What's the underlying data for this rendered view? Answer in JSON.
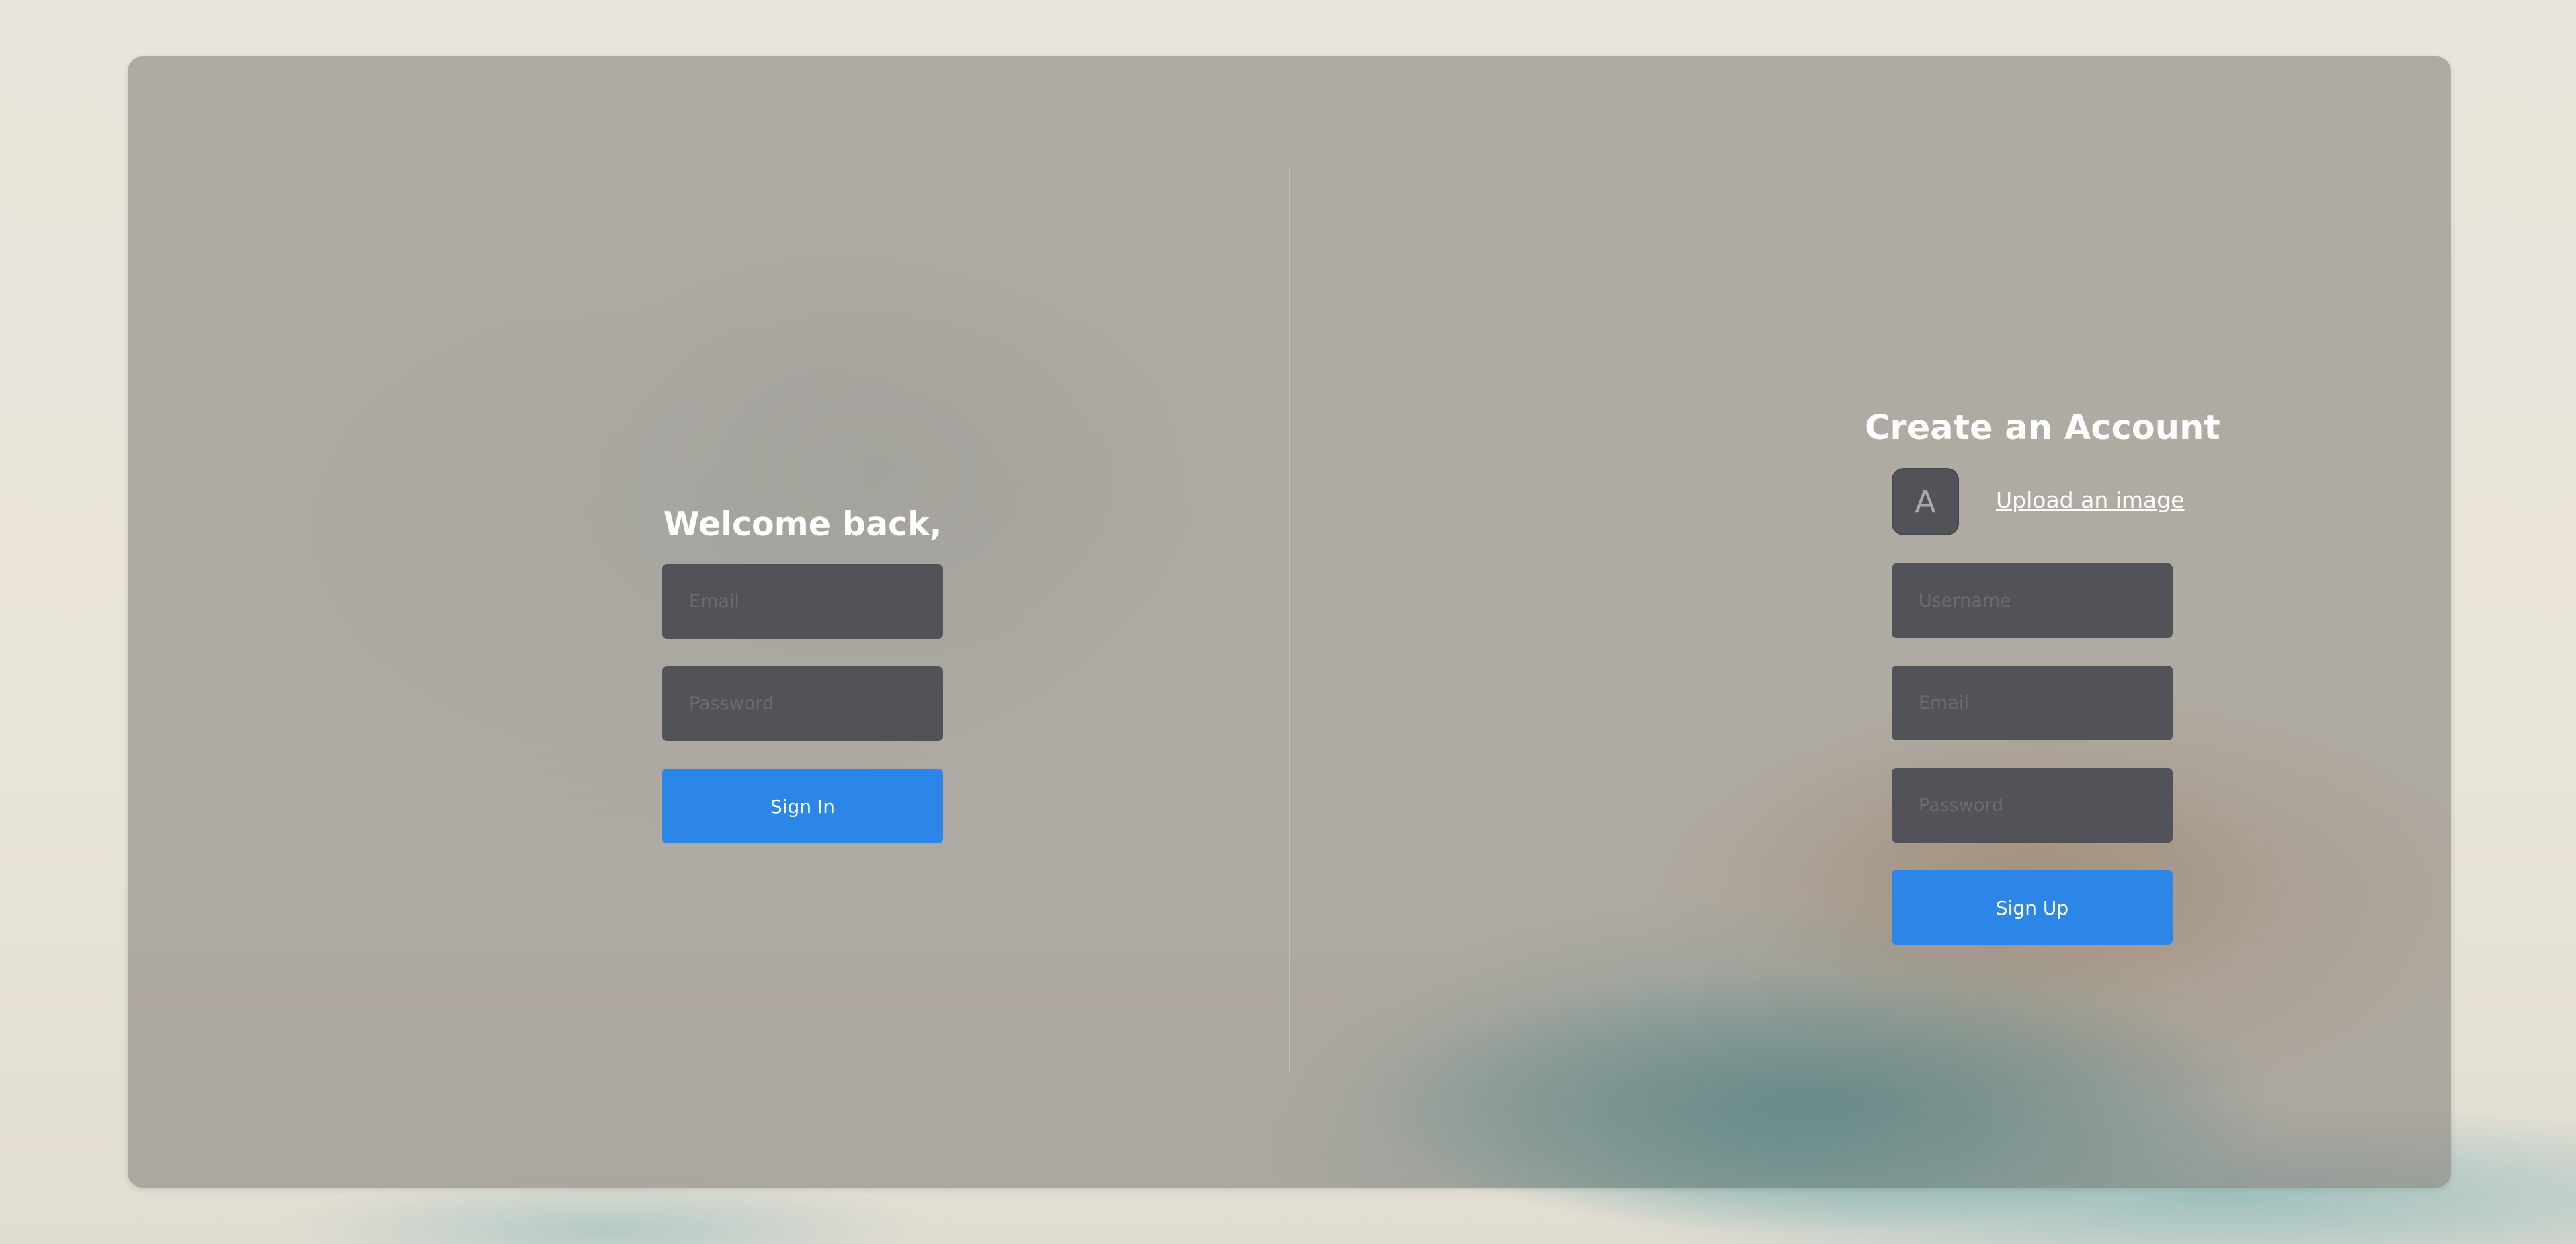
{
  "sign_in": {
    "title": "Welcome back,",
    "email_placeholder": "Email",
    "password_placeholder": "Password",
    "submit_label": "Sign In"
  },
  "sign_up": {
    "title": "Create an Account",
    "avatar_initial": "A",
    "upload_label": "Upload an image",
    "username_placeholder": "Username",
    "email_placeholder": "Email",
    "password_placeholder": "Password",
    "submit_label": "Sign Up"
  },
  "colors": {
    "accent": "#2b86e7",
    "input_bg": "#525358",
    "panel_overlay": "#8a8680"
  }
}
